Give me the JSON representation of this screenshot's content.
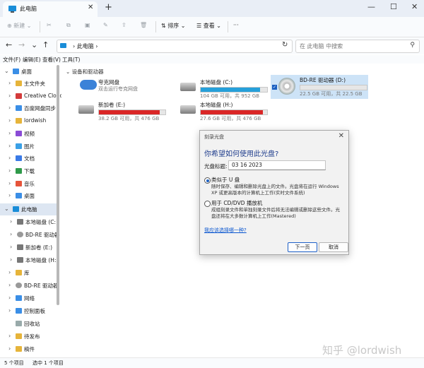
{
  "tab": {
    "title": "此电脑",
    "close": "✕"
  },
  "new_tab": "+",
  "window_controls": {
    "minimize": "—",
    "maximize": "☐",
    "close": "✕"
  },
  "toolbar": {
    "new": "新建",
    "cut": "✂",
    "copy": "⧉",
    "paste": "▣",
    "rename": "✎",
    "share": "⇪",
    "delete": "🗑",
    "sort": "排序",
    "view": "查看",
    "more": "···"
  },
  "nav": {
    "back": "←",
    "forward": "→",
    "down": "⌄",
    "up": "↑"
  },
  "address": {
    "path": "此电脑",
    "refresh": "↻"
  },
  "search": {
    "placeholder": "在 此电脑 中搜索"
  },
  "menu": {
    "file": "文件(F)",
    "edit": "编辑(E)",
    "view": "查看(V)",
    "tools": "工具(T)"
  },
  "sidebar": {
    "items": [
      {
        "label": "桌面",
        "color": "#3a8ee6"
      },
      {
        "label": "主文件夹",
        "color": "#e6b43a"
      },
      {
        "label": "Creative Cloud",
        "color": "#d33b3b"
      },
      {
        "label": "百度网盘同步",
        "color": "#3a8ee6"
      },
      {
        "label": "lordwish",
        "color": "#e6b43a"
      },
      {
        "label": "视频",
        "color": "#8a4bd6"
      },
      {
        "label": "图片",
        "color": "#3aa0e6"
      },
      {
        "label": "文档",
        "color": "#3a7ae6"
      },
      {
        "label": "下载",
        "color": "#2f9a4a"
      },
      {
        "label": "音乐",
        "color": "#e6543a"
      },
      {
        "label": "桌面",
        "color": "#3a8ee6"
      },
      {
        "label": "此电脑",
        "color": "#1a8dd8"
      },
      {
        "label": "本地磁盘 (C:)",
        "color": "#777777"
      },
      {
        "label": "BD-RE 驱动器",
        "color": "#999999"
      },
      {
        "label": "新加卷 (E:)",
        "color": "#777777"
      },
      {
        "label": "本地磁盘 (H:)",
        "color": "#777777"
      },
      {
        "label": "库",
        "color": "#e6b43a"
      },
      {
        "label": "BD-RE 驱动器",
        "color": "#999999"
      },
      {
        "label": "网络",
        "color": "#3a8ee6"
      },
      {
        "label": "控制面板",
        "color": "#3a8ee6"
      },
      {
        "label": "回收站",
        "color": "#9aa"
      },
      {
        "label": "待发布",
        "color": "#e6b43a"
      },
      {
        "label": "稿件",
        "color": "#e6b43a"
      }
    ]
  },
  "content": {
    "group_label": "设备和驱动器",
    "drives": [
      {
        "name": "夸克网盘",
        "cap": "双击运行夸克网盘",
        "fill": 0,
        "fill_color": "#26a0da"
      },
      {
        "name": "本地磁盘 (C:)",
        "cap": "104 GB 可用，共 952 GB",
        "fill": 0.89,
        "fill_color": "#26a0da"
      },
      {
        "name": "BD-RE 驱动器 (D:)",
        "cap": "22.5 GB 可用，共 22.5 GB",
        "fill": 0.0,
        "fill_color": "#26a0da",
        "checked": true
      },
      {
        "name": "新加卷 (E:)",
        "cap": "38.2 GB 可用，共 476 GB",
        "fill": 0.92,
        "fill_color": "#da2626"
      },
      {
        "name": "本地磁盘 (H:)",
        "cap": "27.6 GB 可用，共 476 GB",
        "fill": 0.94,
        "fill_color": "#da2626"
      }
    ]
  },
  "dialog": {
    "title": "刻录光盘",
    "heading": "你希望如何使用此光盘?",
    "label": "光盘标题:",
    "value": "03 16 2023",
    "option1_title": "类似于 U 盘",
    "option1_desc": "随时保存、编辑和删除光盘上的文件。光盘将在运行 Windows XP 或更高版本的计算机上工作(实时文件系统)",
    "option2_title": "用于 CD/DVD 播放机",
    "option2_desc": "成组刻录文件和单独刻录文件后将无法编辑或删除这些文件。光盘还将在大多数计算机上工作(Mastered)",
    "link": "我应该选择哪一种?",
    "next": "下一页",
    "cancel": "取消"
  },
  "status": {
    "count": "5 个项目",
    "selected": "选中 1 个项目"
  },
  "watermark": "知乎 @lordwish"
}
